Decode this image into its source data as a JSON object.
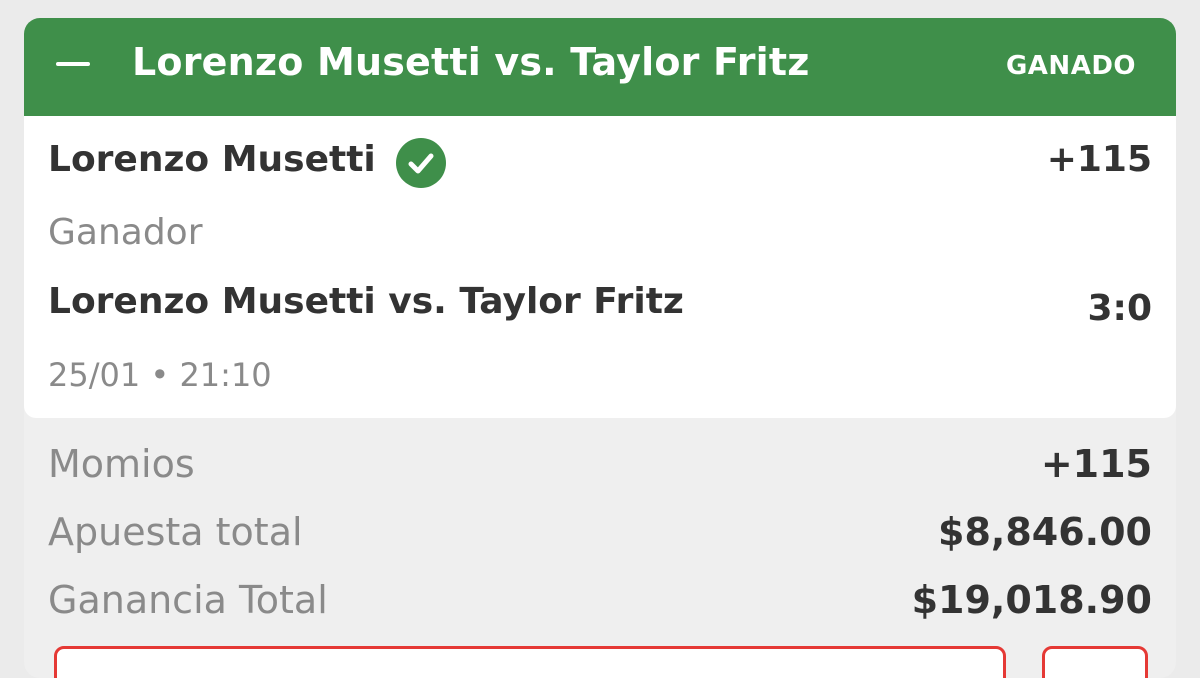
{
  "header": {
    "title": "Lorenzo Musetti vs. Taylor Fritz",
    "status": "GANADO"
  },
  "selection": {
    "name": "Lorenzo Musetti",
    "odds": "+115",
    "market": "Ganador",
    "event": "Lorenzo Musetti vs. Taylor Fritz",
    "score": "3:0",
    "datetime": "25/01 • 21:10"
  },
  "summary": {
    "odds_label": "Momios",
    "odds_value": "+115",
    "stake_label": "Apuesta total",
    "stake_value": "$8,846.00",
    "winnings_label": "Ganancia Total",
    "winnings_value": "$19,018.90"
  },
  "colors": {
    "accent_green": "#3f8f4a",
    "action_red": "#e53935"
  },
  "icons": {
    "collapse": "minus-icon",
    "won": "check-circle-icon"
  }
}
